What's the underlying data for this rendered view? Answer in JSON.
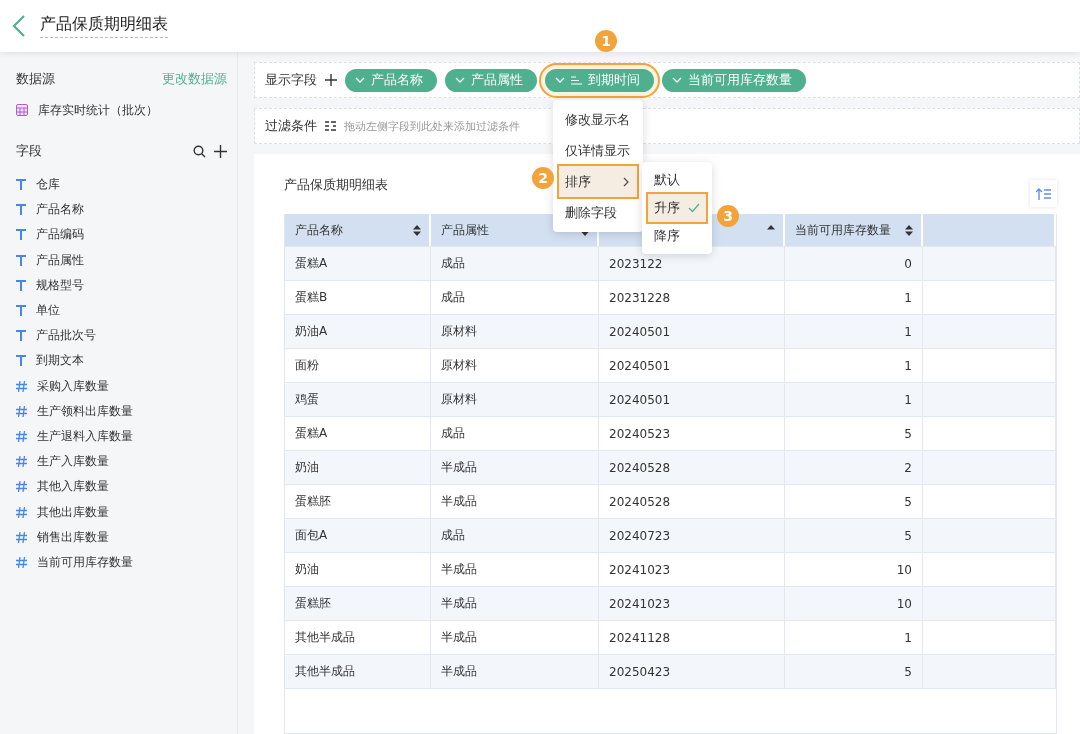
{
  "header": {
    "title": "产品保质期明细表"
  },
  "sidebar": {
    "datasource_label": "数据源",
    "change_link": "更改数据源",
    "datasource": "库存实时统计（批次）",
    "fields_label": "字段",
    "fields": [
      {
        "kind": "text",
        "label": "仓库"
      },
      {
        "kind": "text",
        "label": "产品名称"
      },
      {
        "kind": "text",
        "label": "产品编码"
      },
      {
        "kind": "text",
        "label": "产品属性"
      },
      {
        "kind": "text",
        "label": "规格型号"
      },
      {
        "kind": "text",
        "label": "单位"
      },
      {
        "kind": "text",
        "label": "产品批次号"
      },
      {
        "kind": "text",
        "label": "到期文本"
      },
      {
        "kind": "number",
        "label": "采购入库数量"
      },
      {
        "kind": "number",
        "label": "生产领料出库数量"
      },
      {
        "kind": "number",
        "label": "生产退料入库数量"
      },
      {
        "kind": "number",
        "label": "生产入库数量"
      },
      {
        "kind": "number",
        "label": "其他入库数量"
      },
      {
        "kind": "number",
        "label": "其他出库数量"
      },
      {
        "kind": "number",
        "label": "销售出库数量"
      },
      {
        "kind": "number",
        "label": "当前可用库存数量"
      }
    ]
  },
  "display_fields": {
    "label": "显示字段",
    "chips": [
      {
        "label": "产品名称",
        "sorted": false,
        "highlighted": false
      },
      {
        "label": "产品属性",
        "sorted": false,
        "highlighted": false
      },
      {
        "label": "到期时间",
        "sorted": true,
        "highlighted": true
      },
      {
        "label": "当前可用库存数量",
        "sorted": false,
        "highlighted": false
      }
    ]
  },
  "filter": {
    "label": "过滤条件",
    "placeholder": "拖动左侧字段到此处来添加过滤条件"
  },
  "context_menu": {
    "items": [
      {
        "label": "修改显示名",
        "highlighted": false,
        "submenu": false
      },
      {
        "label": "仅详情显示",
        "highlighted": false,
        "submenu": false
      },
      {
        "label": "排序",
        "highlighted": true,
        "submenu": true
      },
      {
        "label": "删除字段",
        "highlighted": false,
        "submenu": false
      }
    ],
    "submenu": [
      {
        "label": "默认",
        "selected": false,
        "highlighted": false
      },
      {
        "label": "升序",
        "selected": true,
        "highlighted": true
      },
      {
        "label": "降序",
        "selected": false,
        "highlighted": false
      }
    ]
  },
  "step_badges": [
    "1",
    "2",
    "3"
  ],
  "table": {
    "title": "产品保质期明细表",
    "columns": [
      {
        "label": "产品名称",
        "sort_up": true,
        "sort_down": true,
        "numeric": false
      },
      {
        "label": "产品属性",
        "sort_up": false,
        "sort_down": true,
        "numeric": false
      },
      {
        "sort_up": true,
        "sort_down": false,
        "numeric": false
      },
      {
        "label": "当前可用库存数量",
        "sort_up": true,
        "sort_down": true,
        "numeric": true
      }
    ],
    "rows": [
      [
        "蛋糕A",
        "成品",
        "2023122",
        "0"
      ],
      [
        "蛋糕B",
        "成品",
        "20231228",
        "1"
      ],
      [
        "奶油A",
        "原材料",
        "20240501",
        "1"
      ],
      [
        "面粉",
        "原材料",
        "20240501",
        "1"
      ],
      [
        "鸡蛋",
        "原材料",
        "20240501",
        "1"
      ],
      [
        "蛋糕A",
        "成品",
        "20240523",
        "5"
      ],
      [
        "奶油",
        "半成品",
        "20240528",
        "2"
      ],
      [
        "蛋糕胚",
        "半成品",
        "20240528",
        "5"
      ],
      [
        "面包A",
        "成品",
        "20240723",
        "5"
      ],
      [
        "奶油",
        "半成品",
        "20241023",
        "10"
      ],
      [
        "蛋糕胚",
        "半成品",
        "20241023",
        "10"
      ],
      [
        "其他半成品",
        "半成品",
        "20241128",
        "1"
      ],
      [
        "其他半成品",
        "半成品",
        "20250423",
        "5"
      ]
    ]
  }
}
